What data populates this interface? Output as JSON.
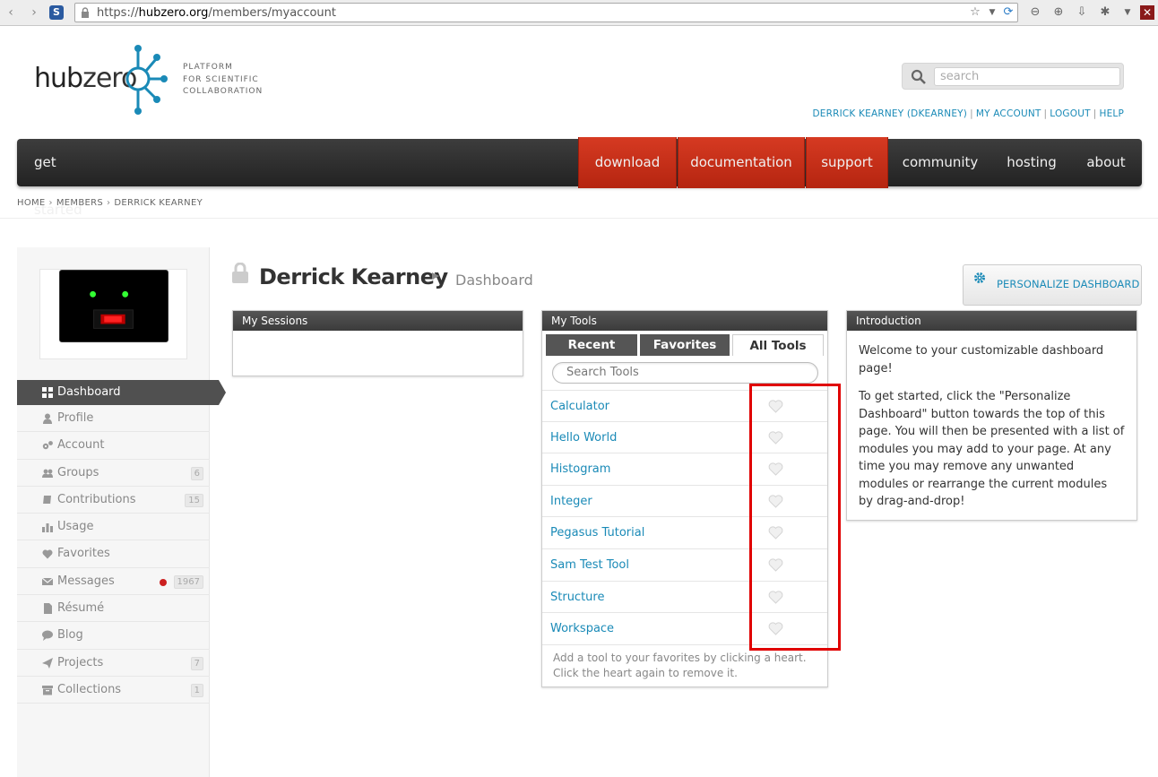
{
  "browser": {
    "url_prefix": "https://",
    "url_host": "hubzero.org",
    "url_path": "/members/myaccount"
  },
  "header": {
    "logo_hub": "hub",
    "logo_zero": "zero",
    "tagline_1": "PLATFORM",
    "tagline_2": "FOR SCIENTIFIC",
    "tagline_3": "COLLABORATION",
    "search_placeholder": "search",
    "user_link": "DERRICK KEARNEY (DKEARNEY)",
    "my_account": "MY ACCOUNT",
    "logout": "LOGOUT",
    "help": "HELP",
    "separator": "|"
  },
  "nav": {
    "get_started": "get started",
    "download": "download",
    "documentation": "documentation",
    "support": "support",
    "community": "community",
    "hosting": "hosting",
    "about": "about"
  },
  "breadcrumb": {
    "home": "HOME",
    "members": "MEMBERS",
    "current": "DERRICK KEARNEY",
    "sep": "›"
  },
  "sidebar": {
    "items": [
      {
        "label": "Dashboard",
        "icon": "grid-icon",
        "active": true
      },
      {
        "label": "Profile",
        "icon": "person-icon"
      },
      {
        "label": "Account",
        "icon": "gears-icon"
      },
      {
        "label": "Groups",
        "icon": "group-icon",
        "badge": "6"
      },
      {
        "label": "Contributions",
        "icon": "book-icon",
        "badge": "15"
      },
      {
        "label": "Usage",
        "icon": "bar-chart-icon"
      },
      {
        "label": "Favorites",
        "icon": "heart-icon"
      },
      {
        "label": "Messages",
        "icon": "envelope-icon",
        "badge": "1967"
      },
      {
        "label": "Résumé",
        "icon": "document-icon"
      },
      {
        "label": "Blog",
        "icon": "speech-bubble-icon"
      },
      {
        "label": "Projects",
        "icon": "paper-plane-icon",
        "badge": "7"
      },
      {
        "label": "Collections",
        "icon": "archive-icon",
        "badge": "1"
      }
    ]
  },
  "page": {
    "title": "Derrick Kearney",
    "subtitle": "Dashboard",
    "personalize_label": "PERSONALIZE DASHBOARD"
  },
  "sessions": {
    "title": "My Sessions"
  },
  "tools": {
    "title": "My Tools",
    "tab_recent": "Recent",
    "tab_favorites": "Favorites",
    "tab_all": "All Tools",
    "search_placeholder": "Search Tools",
    "items": [
      "Calculator",
      "Hello World",
      "Histogram",
      "Integer",
      "Pegasus Tutorial",
      "Sam Test Tool",
      "Structure",
      "Workspace"
    ],
    "help": "Add a tool to your favorites by clicking a heart. Click the heart again to remove it."
  },
  "intro": {
    "title": "Introduction",
    "p1": "Welcome to your customizable dashboard page!",
    "p2": "To get started, click the \"Personalize Dashboard\" button towards the top of this page. You will then be presented with a list of modules you may add to your page. At any time you may remove any unwanted modules or rearrange the current modules by drag-and-drop!"
  },
  "colors": {
    "link": "#1a8ab7",
    "nav_red": "#c7301a",
    "highlight": "#e00000"
  }
}
